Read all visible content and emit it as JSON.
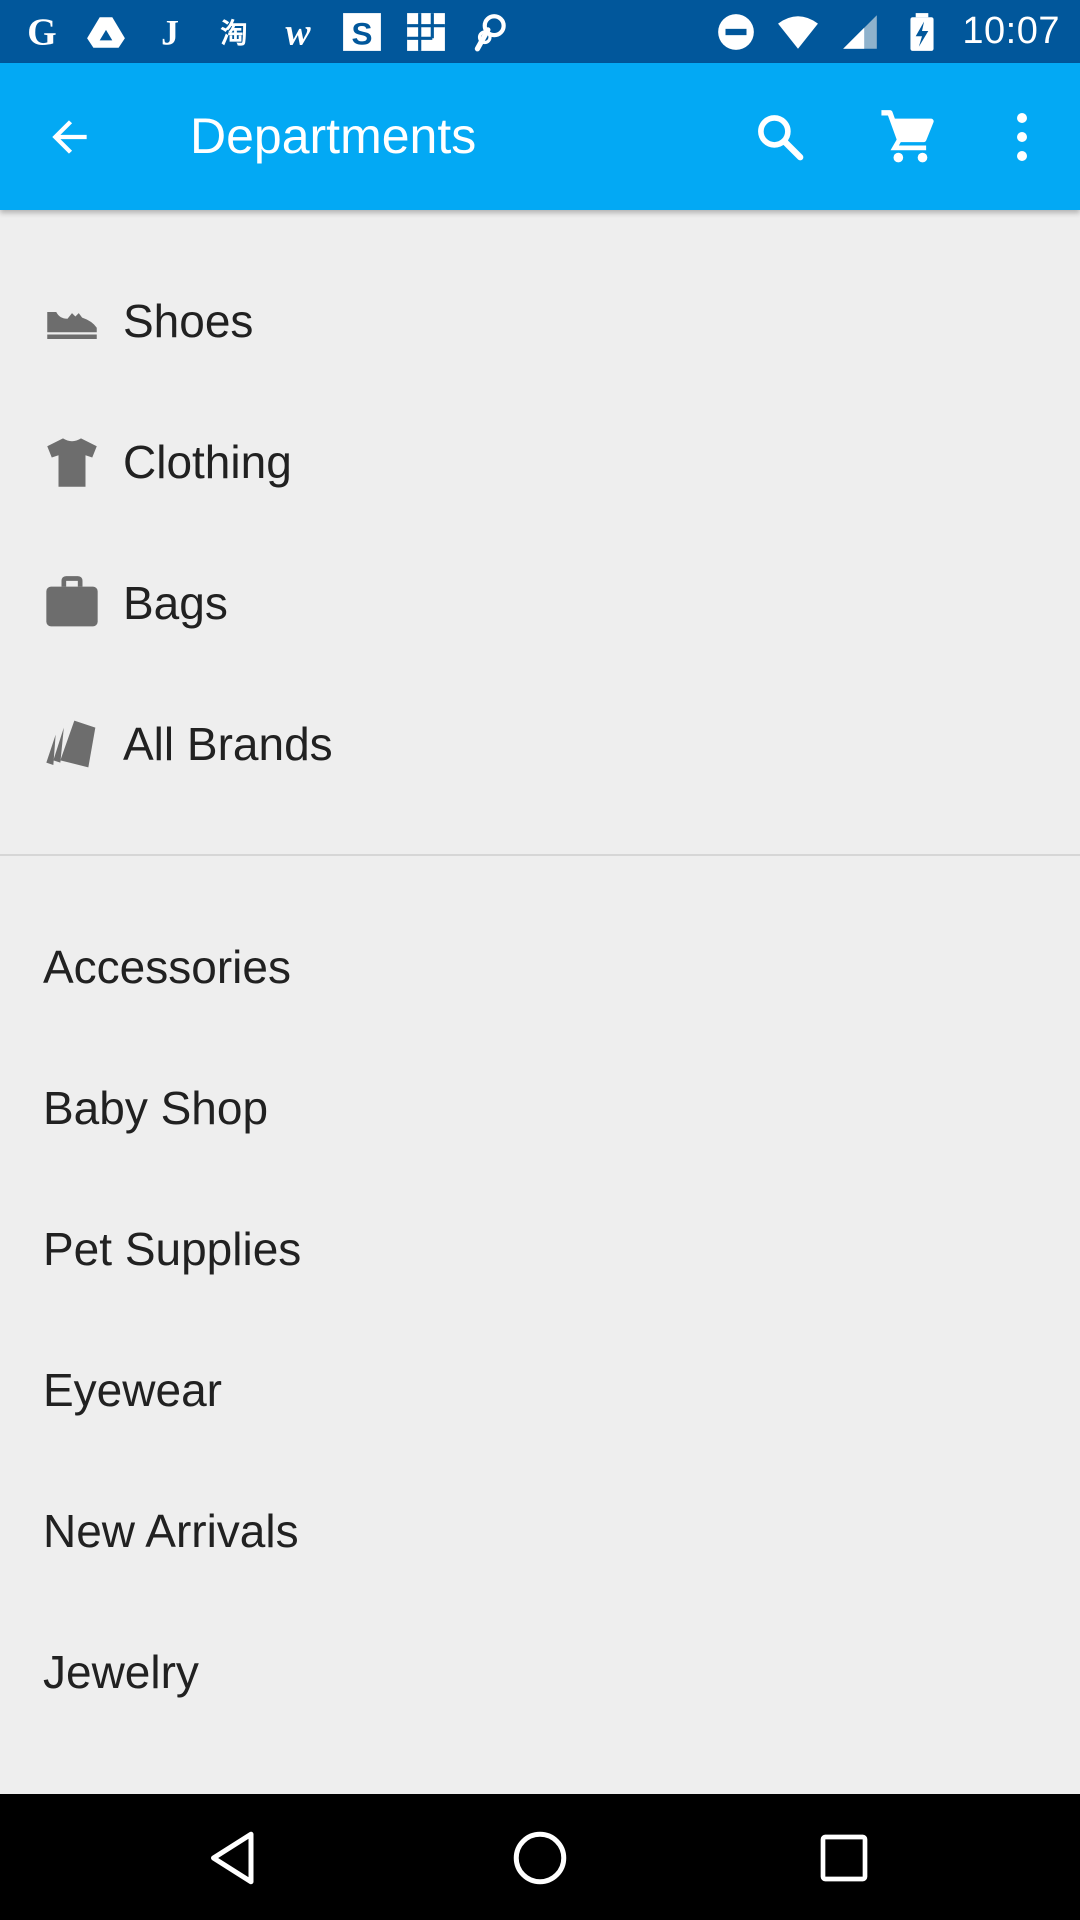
{
  "status_bar": {
    "time": "10:07",
    "left_icons": [
      "google-icon",
      "drive-icon",
      "j-app-icon",
      "taobao-icon",
      "w-app-icon",
      "s-app-icon",
      "grid-app-icon",
      "link-app-icon"
    ],
    "right_icons": [
      "do-not-disturb-icon",
      "wifi-icon",
      "signal-icon",
      "battery-charging-icon"
    ]
  },
  "app_bar": {
    "title": "Departments",
    "color": "#03a9f4",
    "actions": [
      "search-icon",
      "cart-icon",
      "more-vert-icon"
    ]
  },
  "departments": {
    "featured": [
      {
        "label": "Shoes",
        "icon": "shoe-icon"
      },
      {
        "label": "Clothing",
        "icon": "tshirt-icon"
      },
      {
        "label": "Bags",
        "icon": "briefcase-icon"
      },
      {
        "label": "All Brands",
        "icon": "tags-icon"
      }
    ],
    "more": [
      {
        "label": "Accessories"
      },
      {
        "label": "Baby Shop"
      },
      {
        "label": "Pet Supplies"
      },
      {
        "label": "Eyewear"
      },
      {
        "label": "New Arrivals"
      },
      {
        "label": "Jewelry"
      }
    ]
  },
  "colors": {
    "status_bar": "#01579b",
    "background": "#eeeeee",
    "text": "#212121",
    "icon_gray": "#6d6d6d"
  }
}
